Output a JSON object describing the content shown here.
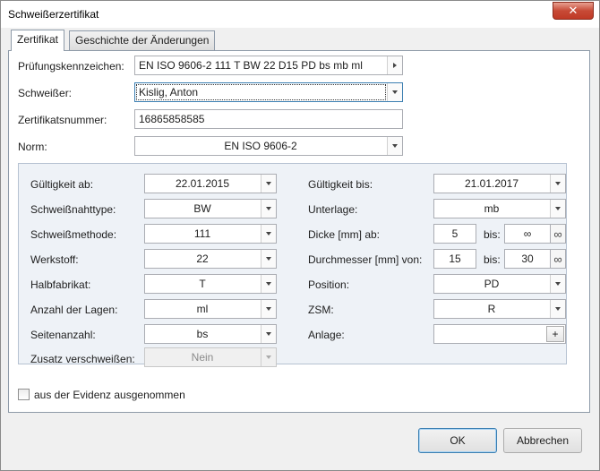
{
  "window": {
    "title": "Schweißerzertifikat",
    "close_label": "✕"
  },
  "tabs": [
    {
      "label": "Zertifikat",
      "active": true
    },
    {
      "label": "Geschichte der Änderungen",
      "active": false
    }
  ],
  "top_fields": {
    "pruefungskennzeichen": {
      "label": "Prüfungskennzeichen:",
      "value": "EN ISO 9606-2 111 T BW 22 D15 PD bs mb ml"
    },
    "schweisser": {
      "label": "Schweißer:",
      "value": "Kislig, Anton"
    },
    "zertifikatsnummer": {
      "label": "Zertifikatsnummer:",
      "value": "16865858585"
    },
    "norm": {
      "label": "Norm:",
      "value": "EN ISO 9606-2"
    }
  },
  "left_fields": [
    {
      "label": "Gültigkeit ab:",
      "value": "22.01.2015"
    },
    {
      "label": "Schweißnahttype:",
      "value": "BW"
    },
    {
      "label": "Schweißmethode:",
      "value": "111"
    },
    {
      "label": "Werkstoff:",
      "value": "22"
    },
    {
      "label": "Halbfabrikat:",
      "value": "T"
    },
    {
      "label": "Anzahl der Lagen:",
      "value": "ml"
    },
    {
      "label": "Seitenanzahl:",
      "value": "bs"
    },
    {
      "label": "Zusatz verschweißen:",
      "value": "Nein"
    }
  ],
  "right_fields": {
    "gueltigkeit_bis": {
      "label": "Gültigkeit bis:",
      "value": "21.01.2017"
    },
    "unterlage": {
      "label": "Unterlage:",
      "value": "mb"
    },
    "dicke": {
      "label": "Dicke [mm] ab:",
      "from": "5",
      "to_label": "bis:",
      "to": "∞",
      "inf": "∞"
    },
    "durchmesser": {
      "label": "Durchmesser [mm] von:",
      "from": "15",
      "to_label": "bis:",
      "to": "30",
      "inf": "∞"
    },
    "position": {
      "label": "Position:",
      "value": "PD"
    },
    "zsm": {
      "label": "ZSM:",
      "value": "R"
    },
    "anlage": {
      "label": "Anlage:",
      "value": "",
      "plus": "+"
    }
  },
  "checkbox": {
    "label": "aus der Evidenz ausgenommen",
    "checked": false
  },
  "buttons": {
    "ok": "OK",
    "cancel": "Abbrechen"
  }
}
